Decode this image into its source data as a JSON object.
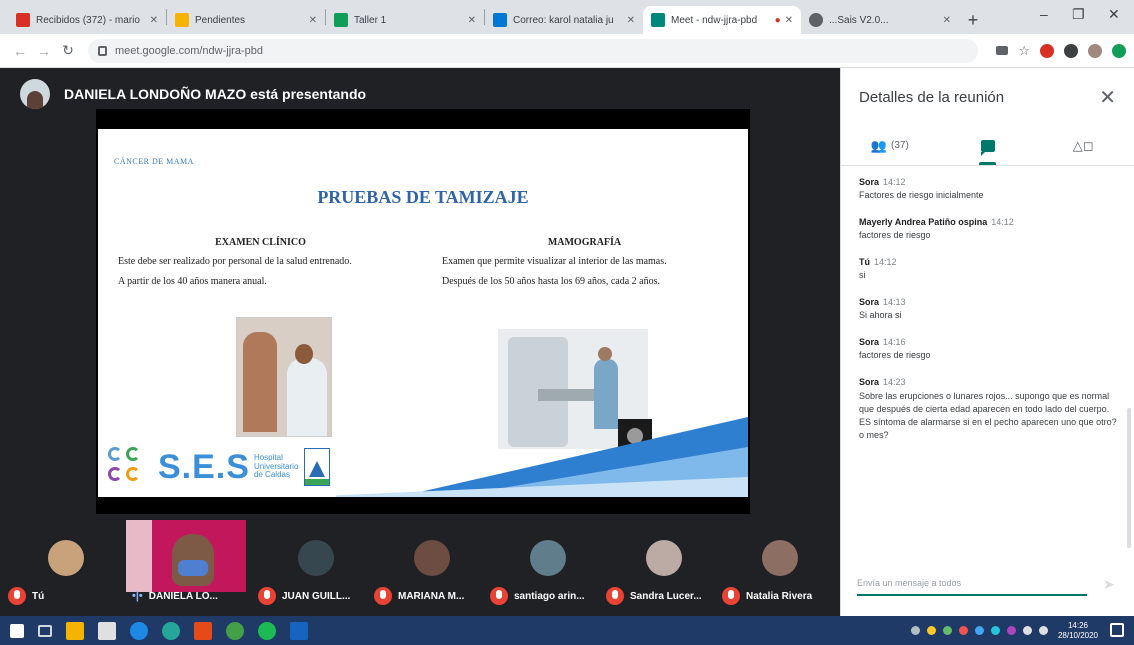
{
  "browser": {
    "tabs": [
      {
        "label": "Recibidos (372) - mario",
        "color": "#d93025"
      },
      {
        "label": "Pendientes",
        "color": "#f4b400"
      },
      {
        "label": "Taller 1",
        "color": "#0f9d58"
      },
      {
        "label": "Correo: karol natalia ju",
        "color": "#0078d4"
      },
      {
        "label": "Meet - ndw-jjra-pbd",
        "color": "#00897b"
      },
      {
        "label": "...Sais V2.0...",
        "color": "#5f6368"
      }
    ],
    "url": "meet.google.com/ndw-jjra-pbd"
  },
  "meet": {
    "presenter_text": "DANIELA LONDOÑO MAZO está presentando"
  },
  "slide": {
    "kicker": "CÁNCER DE MAMA",
    "title": "PRUEBAS DE TAMIZAJE",
    "left": {
      "heading": "EXAMEN CLÍNICO",
      "p1": "Este debe ser realizado por personal de la salud entrenado.",
      "p2": "A partir de los 40 años manera anual."
    },
    "right": {
      "heading": "MAMOGRAFÍA",
      "p1": "Examen que permite visualizar al interior de las mamas.",
      "p2": "Después de los 50 años hasta los 69 años, cada 2 años."
    },
    "logo": {
      "ses": "S.E.S",
      "hospital": [
        "Hospital",
        "Universitario",
        "de Caldas"
      ]
    }
  },
  "participants": [
    {
      "name": "Tú"
    },
    {
      "name": "DANIELA LO..."
    },
    {
      "name": "JUAN GUILL..."
    },
    {
      "name": "MARIANA M..."
    },
    {
      "name": "santiago arin..."
    },
    {
      "name": "Sandra Lucer..."
    },
    {
      "name": "Natalia Rivera"
    }
  ],
  "panel": {
    "title": "Detalles de la reunión",
    "people_count": "(37)",
    "messages": [
      {
        "sender": "Sora",
        "time": "14:12",
        "text": "Factores de riesgo inicialmente"
      },
      {
        "sender": "Mayerly Andrea Patiño ospina",
        "time": "14:12",
        "text": "factores de riesgo"
      },
      {
        "sender": "Tú",
        "time": "14:12",
        "text": "si"
      },
      {
        "sender": "Sora",
        "time": "14:13",
        "text": "Si ahora si"
      },
      {
        "sender": "Sora",
        "time": "14:16",
        "text": "factores de riesgo"
      },
      {
        "sender": "Sora",
        "time": "14:23",
        "text": "Sobre las erupciones o lunares rojos... supongo que es normal que después de cierta edad aparecen en todo lado del cuerpo. ES síntoma de alarmarse si en el pecho aparecen uno que otro? o mes?"
      }
    ],
    "compose_placeholder": "Envía un mensaje a todos"
  },
  "taskbar": {
    "time": "14:26",
    "date": "28/10/2020"
  }
}
